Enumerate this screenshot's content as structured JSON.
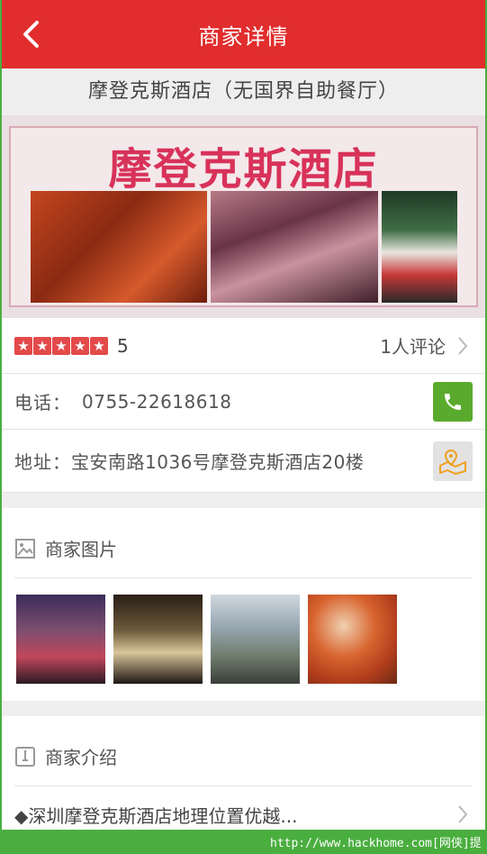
{
  "header": {
    "title": "商家详情"
  },
  "shop": {
    "name": "摩登克斯酒店（无国界自助餐厅）",
    "banner_text": "摩登克斯酒店",
    "rating_score": "5",
    "rating_stars": 5,
    "reviews_label": "1人评论",
    "phone_label": "电话：",
    "phone_value": "0755-22618618",
    "address_label": "地址：",
    "address_value": "宝安南路1036号摩登克斯酒店20楼"
  },
  "photos_section": {
    "title": "商家图片"
  },
  "intro_section": {
    "title": "商家介绍",
    "summary": "◆深圳摩登克斯酒店地理位置优越..."
  },
  "watermark": "http://www.hackhome.com[网侠]提供",
  "colors": {
    "header": "#e12d2d",
    "star": "#e34a4a",
    "phone_button": "#5aab2d",
    "map_icon": "#f0a020"
  },
  "icons": [
    "back-arrow-icon",
    "star-icon",
    "chevron-right-icon",
    "phone-icon",
    "map-location-icon",
    "image-icon",
    "info-icon"
  ]
}
